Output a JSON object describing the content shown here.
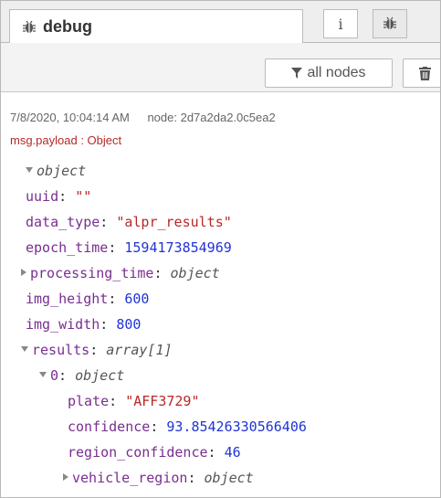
{
  "tab": {
    "title": "debug",
    "icon": "bug-icon"
  },
  "sidebar_buttons": {
    "info_label": "i",
    "info_icon": "info-icon",
    "debug_icon": "bug-icon"
  },
  "toolbar": {
    "filter_label": "all nodes",
    "filter_icon": "filter-icon",
    "clear_icon": "trash-icon"
  },
  "message": {
    "timestamp": "7/8/2020, 10:04:14 AM",
    "node_label": "node: 2d7a2da2.0c5ea2",
    "topic": "msg.payload : Object",
    "root_type": "object",
    "uuid_key": "uuid",
    "uuid_val": "\"\"",
    "data_type_key": "data_type",
    "data_type_val": "\"alpr_results\"",
    "epoch_key": "epoch_time",
    "epoch_val": "1594173854969",
    "processing_key": "processing_time",
    "processing_type": "object",
    "img_height_key": "img_height",
    "img_height_val": "600",
    "img_width_key": "img_width",
    "img_width_val": "800",
    "results_key": "results",
    "results_type": "array[1]",
    "item0_key": "0",
    "item0_type": "object",
    "plate_key": "plate",
    "plate_val": "\"AFF3729\"",
    "confidence_key": "confidence",
    "confidence_val": "93.85426330566406",
    "region_conf_key": "region_confidence",
    "region_conf_val": "46",
    "vehicle_region_key": "vehicle_region",
    "vehicle_region_type": "object"
  },
  "colors": {
    "key": "#792e90",
    "string": "#b72828",
    "number": "#2033d6"
  }
}
